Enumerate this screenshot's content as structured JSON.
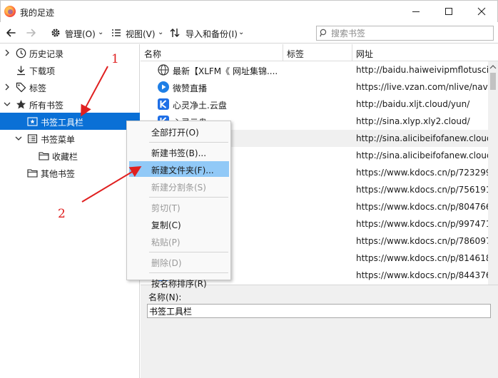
{
  "window": {
    "title": "我的足迹",
    "controls": [
      "minimize",
      "maximize",
      "close"
    ]
  },
  "toolbar": {
    "back_icon": "back-arrow-icon",
    "forward_icon": "forward-arrow-icon",
    "organize_label": "管理(O)",
    "views_label": "视图(V)",
    "import_backup_label": "导入和备份(I)",
    "search_placeholder": "搜索书签"
  },
  "sidebar": {
    "items": [
      {
        "label": "历史记录",
        "icon": "clock-icon",
        "expander": "collapsed"
      },
      {
        "label": "下载项",
        "icon": "download-icon",
        "expander": "none"
      },
      {
        "label": "标签",
        "icon": "tag-icon",
        "expander": "collapsed"
      },
      {
        "label": "所有书签",
        "icon": "star-icon",
        "expander": "expanded"
      },
      {
        "label": "书签工具栏",
        "icon": "bookmarks-toolbar-icon",
        "expander": "none",
        "selected": true
      },
      {
        "label": "书签菜单",
        "icon": "bookmarks-menu-icon",
        "expander": "expanded"
      },
      {
        "label": "收藏栏",
        "icon": "folder-icon",
        "expander": "none"
      },
      {
        "label": "其他书签",
        "icon": "folder-icon",
        "expander": "none"
      }
    ]
  },
  "columns": {
    "name": "名称",
    "tags": "标签",
    "location": "网址"
  },
  "rows": [
    {
      "name": "最新【XLFM《 网址集锦....",
      "url": "http://baidu.haiweivipmflotusci...",
      "icon": "globe-icon"
    },
    {
      "name": "微赞直播",
      "url": "https://live.vzan.com/nlive/nav...",
      "icon": "vzan-icon"
    },
    {
      "name": "心灵净土.云盘",
      "url": "http://baidu.xljt.cloud/yun/",
      "icon": "k-logo-icon"
    },
    {
      "name": "心灵云盘",
      "url": "http://sina.xlyp.xly2.cloud/",
      "icon": "k-logo-icon"
    },
    {
      "name": "",
      "url": "http://sina.alicibeifofanew.cloud",
      "icon": "k-logo-icon"
    },
    {
      "name": "净土",
      "url": "http://sina.alicibeifofanew.cloud",
      "icon": "k-logo-icon"
    },
    {
      "name": "锦】",
      "url": "https://www.kdocs.cn/p/723299",
      "icon": "k-logo-icon"
    },
    {
      "name": "台和FH】",
      "url": "https://www.kdocs.cn/p/756191",
      "icon": "k-logo-icon"
    },
    {
      "name": "频网页】",
      "url": "https://www.kdocs.cn/p/804766",
      "icon": "k-logo-icon"
    },
    {
      "name": "页】2021年...",
      "url": "https://www.kdocs.cn/p/997471",
      "icon": "k-logo-icon"
    },
    {
      "name": "度管理表...",
      "url": "https://www.kdocs.cn/p/786097",
      "icon": "k-logo-icon"
    },
    {
      "name": "坛音频制...",
      "url": "https://www.kdocs.cn/p/814618",
      "icon": "k-logo-icon"
    },
    {
      "name": "坛.专题汇...",
      "url": "https://www.kdocs.cn/p/844376",
      "icon": "k-logo-icon"
    }
  ],
  "context_menu": {
    "items": [
      {
        "label": "全部打开(O)",
        "enabled": true
      },
      {
        "separator": true
      },
      {
        "label": "新建书签(B)...",
        "enabled": true
      },
      {
        "label": "新建文件夹(F)...",
        "enabled": true,
        "highlighted": true
      },
      {
        "label": "新建分割条(S)",
        "enabled": false
      },
      {
        "separator": true
      },
      {
        "label": "剪切(T)",
        "enabled": false
      },
      {
        "label": "复制(C)",
        "enabled": true
      },
      {
        "label": "粘贴(P)",
        "enabled": false
      },
      {
        "separator": true
      },
      {
        "label": "删除(D)",
        "enabled": false
      },
      {
        "separator": true
      },
      {
        "label": "按名称排序(R)",
        "enabled": true
      }
    ]
  },
  "details": {
    "name_label": "名称(N):",
    "name_value": "书签工具栏"
  },
  "annotations": {
    "marker_1": "1",
    "marker_2": "2",
    "color": "#e02020"
  },
  "colors": {
    "selection": "#0a70d6",
    "menu_highlight": "#91c9f7"
  }
}
